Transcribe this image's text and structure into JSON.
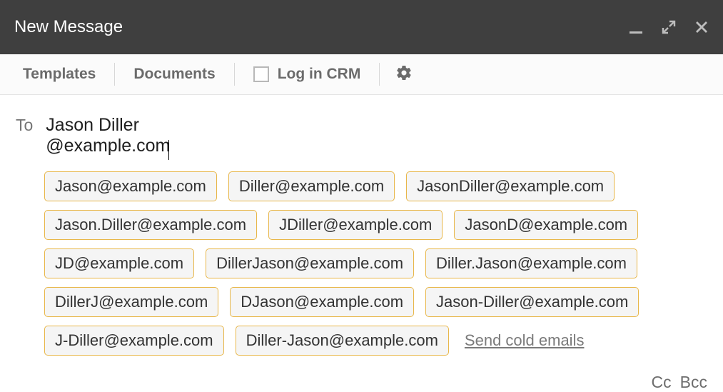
{
  "titlebar": {
    "title": "New Message"
  },
  "toolbar": {
    "templates": "Templates",
    "documents": "Documents",
    "logInCrm": "Log in CRM"
  },
  "compose": {
    "toLabel": "To",
    "toValue": "Jason Diller @example.com",
    "ccLabel": "Cc",
    "bccLabel": "Bcc",
    "sendColdEmails": "Send cold emails",
    "suggestions": [
      "Jason@example.com",
      "Diller@example.com",
      "JasonDiller@example.com",
      "Jason.Diller@example.com",
      "JDiller@example.com",
      "JasonD@example.com",
      "JD@example.com",
      "DillerJason@example.com",
      "Diller.Jason@example.com",
      "DillerJ@example.com",
      "DJason@example.com",
      "Jason-Diller@example.com",
      "J-Diller@example.com",
      "Diller-Jason@example.com"
    ]
  }
}
